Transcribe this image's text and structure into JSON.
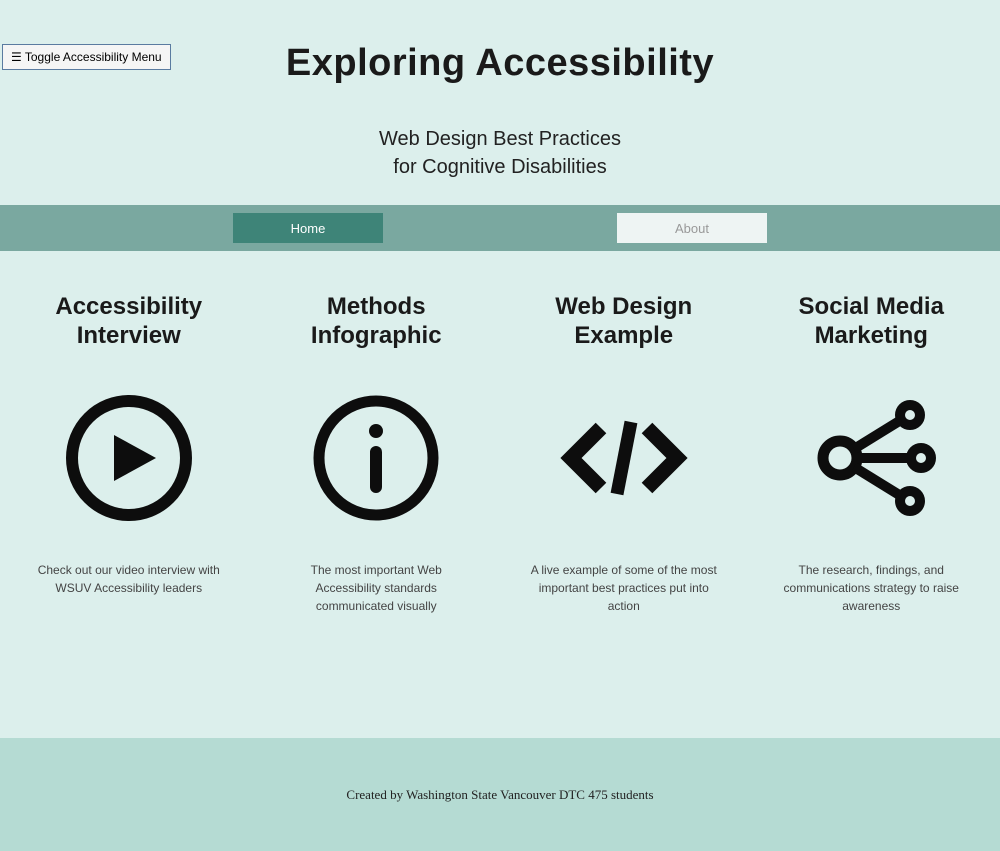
{
  "accessibility_toggle": "☰ Toggle Accessibility Menu",
  "hero": {
    "title": "Exploring Accessibility",
    "subtitle_line1": "Web Design Best Practices",
    "subtitle_line2": "for Cognitive Disabilities"
  },
  "nav": {
    "home": "Home",
    "about": "About"
  },
  "cards": [
    {
      "title": "Accessibility\nInterview",
      "desc": "Check out our video interview with WSUV Accessibility leaders"
    },
    {
      "title": "Methods\nInfographic",
      "desc": "The most important Web Accessibility standards communicated visually"
    },
    {
      "title": "Web Design\nExample",
      "desc": "A live example of some of the most important best practices put into action"
    },
    {
      "title": "Social Media\nMarketing",
      "desc": "The research, findings, and communications strategy to raise awareness"
    }
  ],
  "footer": {
    "text": "Created by Washington State Vancouver DTC 475 students"
  }
}
